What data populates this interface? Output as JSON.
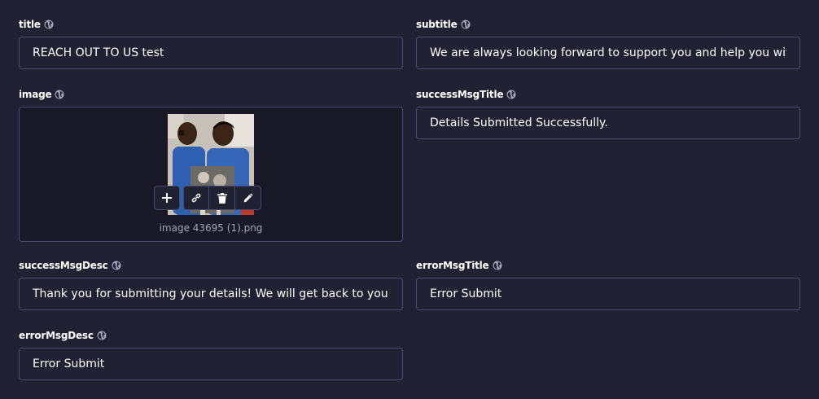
{
  "fields": {
    "title": {
      "label": "title",
      "value": "REACH OUT TO US test"
    },
    "subtitle": {
      "label": "subtitle",
      "value": "We are always looking forward to support you and help you with your queries"
    },
    "image": {
      "label": "image",
      "filename": "image 43695 (1).png"
    },
    "successMsgTitle": {
      "label": "successMsgTitle",
      "value": "Details Submitted Successfully."
    },
    "successMsgDesc": {
      "label": "successMsgDesc",
      "value": "Thank you for submitting your details! We will get back to you shortly."
    },
    "errorMsgTitle": {
      "label": "errorMsgTitle",
      "value": "Error Submit"
    },
    "errorMsgDesc": {
      "label": "errorMsgDesc",
      "value": "Error Submit"
    }
  },
  "icons": {
    "globe": "globe-icon",
    "add": "plus-icon",
    "link": "link-icon",
    "delete": "trash-icon",
    "edit": "pencil-icon"
  },
  "colors": {
    "background": "#212134",
    "border": "#4a4a6a",
    "text": "#ffffff",
    "muted": "#a5a5ba"
  }
}
